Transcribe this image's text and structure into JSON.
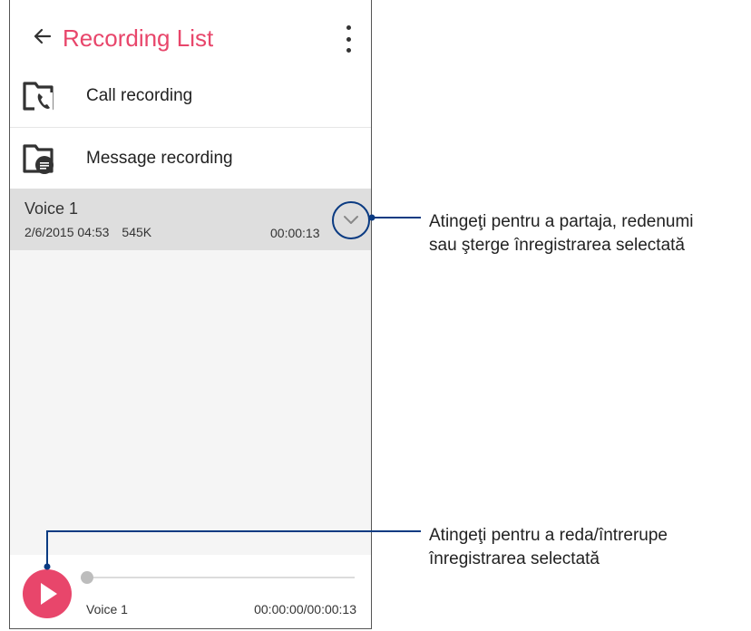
{
  "appbar": {
    "title": "Recording List",
    "back_icon": "arrow-left-icon",
    "menu_icon": "more-vert-icon"
  },
  "folders": [
    {
      "label": "Call recording",
      "icon": "call-recording-folder-icon"
    },
    {
      "label": "Message recording",
      "icon": "message-recording-folder-icon"
    }
  ],
  "recording": {
    "name": "Voice 1",
    "date": "2/6/2015 04:53",
    "size": "545K",
    "duration": "00:00:13",
    "expand_icon": "chevron-down-icon"
  },
  "player": {
    "name": "Voice 1",
    "time": "00:00:00/00:00:13",
    "progress": 0,
    "play_icon": "play-icon"
  },
  "callouts": {
    "options": [
      "Atingeţi pentru a partaja, redenumi",
      "sau şterge înregistrarea selectată"
    ],
    "play": [
      "Atingeţi pentru a reda/întrerupe",
      "înregistrarea selectată"
    ]
  },
  "colors": {
    "accent": "#e8466b",
    "callout": "#0b3b82",
    "selected_row": "#dedede"
  }
}
